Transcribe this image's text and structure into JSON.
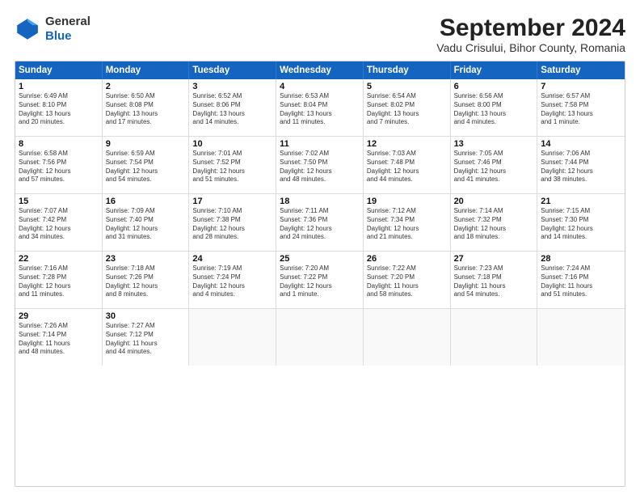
{
  "header": {
    "logo_general": "General",
    "logo_blue": "Blue",
    "title": "September 2024",
    "subtitle": "Vadu Crisului, Bihor County, Romania"
  },
  "calendar": {
    "days_of_week": [
      "Sunday",
      "Monday",
      "Tuesday",
      "Wednesday",
      "Thursday",
      "Friday",
      "Saturday"
    ],
    "weeks": [
      [
        {
          "day": "",
          "info": ""
        },
        {
          "day": "2",
          "info": "Sunrise: 6:50 AM\nSunset: 8:08 PM\nDaylight: 13 hours\nand 17 minutes."
        },
        {
          "day": "3",
          "info": "Sunrise: 6:52 AM\nSunset: 8:06 PM\nDaylight: 13 hours\nand 14 minutes."
        },
        {
          "day": "4",
          "info": "Sunrise: 6:53 AM\nSunset: 8:04 PM\nDaylight: 13 hours\nand 11 minutes."
        },
        {
          "day": "5",
          "info": "Sunrise: 6:54 AM\nSunset: 8:02 PM\nDaylight: 13 hours\nand 7 minutes."
        },
        {
          "day": "6",
          "info": "Sunrise: 6:56 AM\nSunset: 8:00 PM\nDaylight: 13 hours\nand 4 minutes."
        },
        {
          "day": "7",
          "info": "Sunrise: 6:57 AM\nSunset: 7:58 PM\nDaylight: 13 hours\nand 1 minute."
        }
      ],
      [
        {
          "day": "8",
          "info": "Sunrise: 6:58 AM\nSunset: 7:56 PM\nDaylight: 12 hours\nand 57 minutes."
        },
        {
          "day": "9",
          "info": "Sunrise: 6:59 AM\nSunset: 7:54 PM\nDaylight: 12 hours\nand 54 minutes."
        },
        {
          "day": "10",
          "info": "Sunrise: 7:01 AM\nSunset: 7:52 PM\nDaylight: 12 hours\nand 51 minutes."
        },
        {
          "day": "11",
          "info": "Sunrise: 7:02 AM\nSunset: 7:50 PM\nDaylight: 12 hours\nand 48 minutes."
        },
        {
          "day": "12",
          "info": "Sunrise: 7:03 AM\nSunset: 7:48 PM\nDaylight: 12 hours\nand 44 minutes."
        },
        {
          "day": "13",
          "info": "Sunrise: 7:05 AM\nSunset: 7:46 PM\nDaylight: 12 hours\nand 41 minutes."
        },
        {
          "day": "14",
          "info": "Sunrise: 7:06 AM\nSunset: 7:44 PM\nDaylight: 12 hours\nand 38 minutes."
        }
      ],
      [
        {
          "day": "15",
          "info": "Sunrise: 7:07 AM\nSunset: 7:42 PM\nDaylight: 12 hours\nand 34 minutes."
        },
        {
          "day": "16",
          "info": "Sunrise: 7:09 AM\nSunset: 7:40 PM\nDaylight: 12 hours\nand 31 minutes."
        },
        {
          "day": "17",
          "info": "Sunrise: 7:10 AM\nSunset: 7:38 PM\nDaylight: 12 hours\nand 28 minutes."
        },
        {
          "day": "18",
          "info": "Sunrise: 7:11 AM\nSunset: 7:36 PM\nDaylight: 12 hours\nand 24 minutes."
        },
        {
          "day": "19",
          "info": "Sunrise: 7:12 AM\nSunset: 7:34 PM\nDaylight: 12 hours\nand 21 minutes."
        },
        {
          "day": "20",
          "info": "Sunrise: 7:14 AM\nSunset: 7:32 PM\nDaylight: 12 hours\nand 18 minutes."
        },
        {
          "day": "21",
          "info": "Sunrise: 7:15 AM\nSunset: 7:30 PM\nDaylight: 12 hours\nand 14 minutes."
        }
      ],
      [
        {
          "day": "22",
          "info": "Sunrise: 7:16 AM\nSunset: 7:28 PM\nDaylight: 12 hours\nand 11 minutes."
        },
        {
          "day": "23",
          "info": "Sunrise: 7:18 AM\nSunset: 7:26 PM\nDaylight: 12 hours\nand 8 minutes."
        },
        {
          "day": "24",
          "info": "Sunrise: 7:19 AM\nSunset: 7:24 PM\nDaylight: 12 hours\nand 4 minutes."
        },
        {
          "day": "25",
          "info": "Sunrise: 7:20 AM\nSunset: 7:22 PM\nDaylight: 12 hours\nand 1 minute."
        },
        {
          "day": "26",
          "info": "Sunrise: 7:22 AM\nSunset: 7:20 PM\nDaylight: 11 hours\nand 58 minutes."
        },
        {
          "day": "27",
          "info": "Sunrise: 7:23 AM\nSunset: 7:18 PM\nDaylight: 11 hours\nand 54 minutes."
        },
        {
          "day": "28",
          "info": "Sunrise: 7:24 AM\nSunset: 7:16 PM\nDaylight: 11 hours\nand 51 minutes."
        }
      ],
      [
        {
          "day": "29",
          "info": "Sunrise: 7:26 AM\nSunset: 7:14 PM\nDaylight: 11 hours\nand 48 minutes."
        },
        {
          "day": "30",
          "info": "Sunrise: 7:27 AM\nSunset: 7:12 PM\nDaylight: 11 hours\nand 44 minutes."
        },
        {
          "day": "",
          "info": ""
        },
        {
          "day": "",
          "info": ""
        },
        {
          "day": "",
          "info": ""
        },
        {
          "day": "",
          "info": ""
        },
        {
          "day": "",
          "info": ""
        }
      ]
    ],
    "week1_sunday": {
      "day": "1",
      "info": "Sunrise: 6:49 AM\nSunset: 8:10 PM\nDaylight: 13 hours\nand 20 minutes."
    }
  }
}
